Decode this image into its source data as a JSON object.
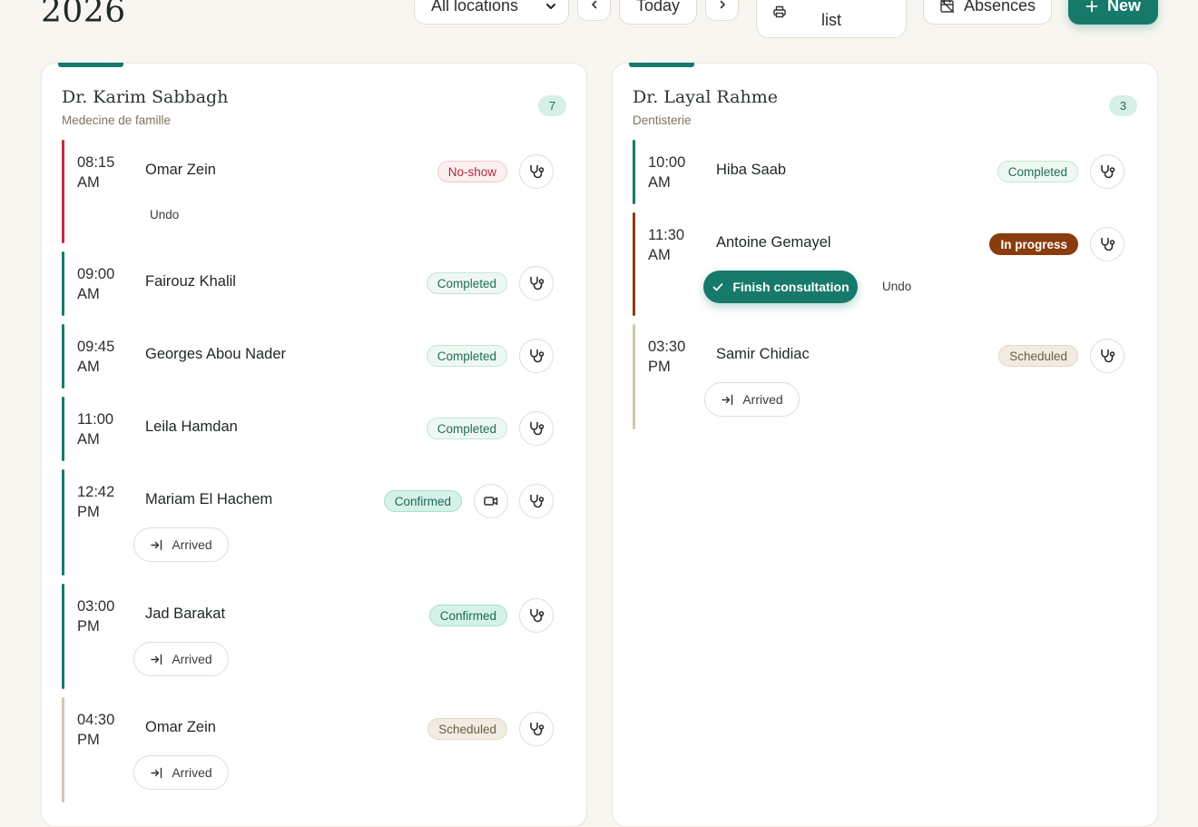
{
  "header": {
    "year": "2026",
    "location_select": "All locations",
    "today_label": "Today",
    "print_label": "list",
    "absences_label": "Absences",
    "new_label": "New"
  },
  "columns": [
    {
      "doctor": "Dr. Karim Sabbagh",
      "specialty": "Medecine de famille",
      "count": "7",
      "appointments": [
        {
          "time": "08:15\nAM",
          "patient": "Omar Zein",
          "status": "No-show",
          "undo": "Undo"
        },
        {
          "time": "09:00\nAM",
          "patient": "Fairouz Khalil",
          "status": "Completed"
        },
        {
          "time": "09:45\nAM",
          "patient": "Georges Abou Nader",
          "status": "Completed"
        },
        {
          "time": "11:00\nAM",
          "patient": "Leila Hamdan",
          "status": "Completed"
        },
        {
          "time": "12:42\nPM",
          "patient": "Mariam El Hachem",
          "status": "Confirmed",
          "arrived": "Arrived"
        },
        {
          "time": "03:00\nPM",
          "patient": "Jad Barakat",
          "status": "Confirmed",
          "arrived": "Arrived"
        },
        {
          "time": "04:30\nPM",
          "patient": "Omar Zein",
          "status": "Scheduled",
          "arrived": "Arrived"
        }
      ]
    },
    {
      "doctor": "Dr. Layal Rahme",
      "specialty": "Dentisterie",
      "count": "3",
      "appointments": [
        {
          "time": "10:00\nAM",
          "patient": "Hiba Saab",
          "status": "Completed"
        },
        {
          "time": "11:30\nAM",
          "patient": "Antoine Gemayel",
          "status": "In progress",
          "finish": "Finish consultation",
          "undo": "Undo"
        },
        {
          "time": "03:30\nPM",
          "patient": "Samir Chidiac",
          "status": "Scheduled",
          "arrived": "Arrived"
        }
      ]
    }
  ],
  "icons": {
    "select": "chevron-down-icon",
    "prev": "chevron-left-icon",
    "next": "chevron-right-icon",
    "print": "printer-icon",
    "absences": "calendar-off-icon",
    "new": "plus-icon",
    "appointment_action": "stethoscope-icon",
    "video": "video-icon",
    "arrived": "log-in-icon",
    "finish": "check-icon"
  },
  "colors": {
    "accent": "#17796a",
    "no_show": "#c0303e",
    "confirmed": "#17796a",
    "in_progress": "#8b3c0e",
    "scheduled": "#d4c7b0"
  }
}
